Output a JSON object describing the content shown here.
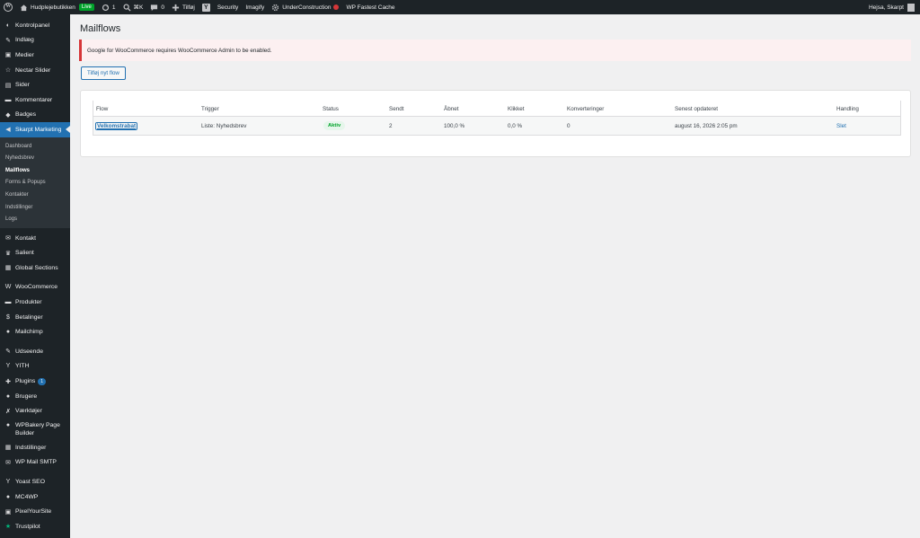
{
  "adminbar": {
    "site_name": "Hudplejebutikken",
    "live_label": "Live",
    "updates_count": "1",
    "search_label": "⌘K",
    "comments_count": "0",
    "add_new_label": "Tilføj",
    "security_label": "Security",
    "imagify_label": "Imagify",
    "underconstruction_label": "UnderConstruction",
    "fastest_cache_label": "WP Fastest Cache",
    "greeting": "Hejsa, Skarpt"
  },
  "sidebar": {
    "items_top": [
      {
        "label": "Kontrolpanel",
        "icon": "dashboard-icon"
      },
      {
        "label": "Indlæg",
        "icon": "pushpin-icon"
      },
      {
        "label": "Medier",
        "icon": "media-icon"
      },
      {
        "label": "Nectar Slider",
        "icon": "star-icon"
      },
      {
        "label": "Sider",
        "icon": "page-icon"
      },
      {
        "label": "Kommentarer",
        "icon": "comment-icon"
      },
      {
        "label": "Badges",
        "icon": "badge-icon"
      },
      {
        "label": "Skarpt Marketing",
        "icon": "megaphone-icon"
      }
    ],
    "submenu": [
      "Dashboard",
      "Nyhedsbrev",
      "Mailflows",
      "Forms & Popups",
      "Kontakter",
      "Indstillinger",
      "Logs"
    ],
    "items_bottom": [
      {
        "label": "Kontakt",
        "icon": "mail-icon"
      },
      {
        "label": "Salient",
        "icon": "crown-icon"
      },
      {
        "label": "Global Sections",
        "icon": "grid-icon"
      },
      {
        "label": "WooCommerce",
        "icon": "woo-icon"
      },
      {
        "label": "Produkter",
        "icon": "archive-icon"
      },
      {
        "label": "Betalinger",
        "icon": "dollar-icon"
      },
      {
        "label": "Mailchimp",
        "icon": "mailchimp-icon"
      },
      {
        "label": "Udseende",
        "icon": "brush-icon"
      },
      {
        "label": "YITH",
        "icon": "yith-icon"
      },
      {
        "label": "Plugins",
        "icon": "plugin-icon",
        "badge": "1"
      },
      {
        "label": "Brugere",
        "icon": "user-icon"
      },
      {
        "label": "Værktøjer",
        "icon": "wrench-icon"
      },
      {
        "label": "WPBakery Page Builder",
        "icon": "wpbakery-icon"
      },
      {
        "label": "Indstillinger",
        "icon": "settings-icon"
      },
      {
        "label": "WP Mail SMTP",
        "icon": "smtp-icon"
      },
      {
        "label": "Yoast SEO",
        "icon": "yoast-icon"
      },
      {
        "label": "MC4WP",
        "icon": "mc4wp-icon"
      },
      {
        "label": "PixelYourSite",
        "icon": "pixel-icon"
      },
      {
        "label": "Trustpilot",
        "icon": "trustpilot-star-icon"
      }
    ]
  },
  "main": {
    "title": "Mailflows",
    "notice": "Google for WooCommerce requires WooCommerce Admin to be enabled.",
    "add_button": "Tilføj nyt flow",
    "table": {
      "headers": [
        "Flow",
        "Trigger",
        "Status",
        "Sendt",
        "Åbnet",
        "Klikket",
        "Konverteringer",
        "Senest opdateret",
        "Handling"
      ],
      "rows": [
        {
          "flow": "Velkomstrabat",
          "trigger": "Liste: Nyhedsbrev",
          "status": "Aktiv",
          "sent": "2",
          "opened": "100,0 %",
          "clicked": "0,0 %",
          "conversions": "0",
          "updated": "august 16, 2026 2:05 pm",
          "action": "Slet"
        }
      ]
    }
  },
  "colors": {
    "admin_bg": "#1d2327",
    "accent": "#2271b1",
    "error": "#d63638",
    "success": "#00a32a"
  }
}
